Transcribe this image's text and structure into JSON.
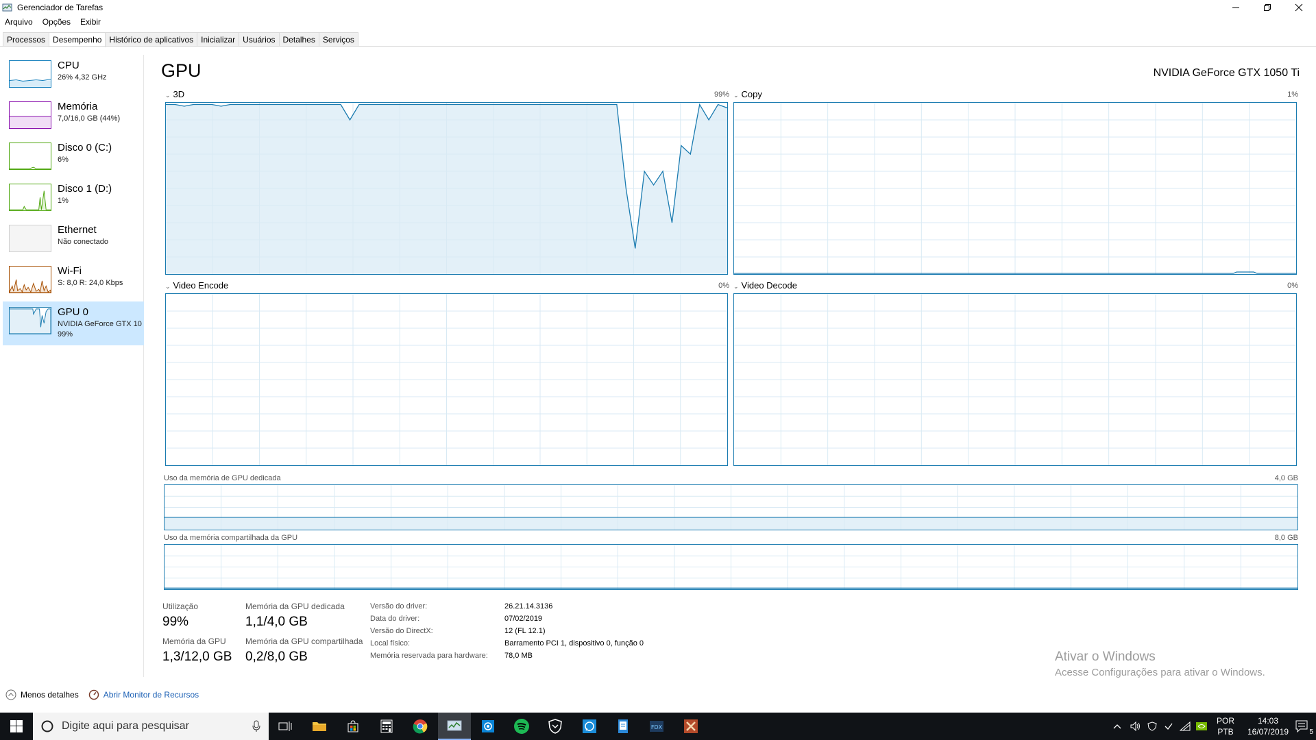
{
  "window": {
    "title": "Gerenciador de Tarefas",
    "menu": [
      "Arquivo",
      "Opções",
      "Exibir"
    ],
    "tabs": [
      "Processos",
      "Desempenho",
      "Histórico de aplicativos",
      "Inicializar",
      "Usuários",
      "Detalhes",
      "Serviços"
    ],
    "active_tab": "Desempenho"
  },
  "sidebar": {
    "items": [
      {
        "label": "CPU",
        "sub": "26% 4,32 GHz",
        "sub2": "",
        "color": "#117dbb"
      },
      {
        "label": "Memória",
        "sub": "7,0/16,0 GB (44%)",
        "sub2": "",
        "color": "#8b12ae"
      },
      {
        "label": "Disco 0 (C:)",
        "sub": "6%",
        "sub2": "",
        "color": "#4da60c"
      },
      {
        "label": "Disco 1 (D:)",
        "sub": "1%",
        "sub2": "",
        "color": "#4da60c"
      },
      {
        "label": "Ethernet",
        "sub": "Não conectado",
        "sub2": "",
        "color": "#a74f01"
      },
      {
        "label": "Wi-Fi",
        "sub": "S: 8,0  R: 24,0 Kbps",
        "sub2": "",
        "color": "#a74f01"
      },
      {
        "label": "GPU 0",
        "sub": "NVIDIA GeForce GTX 10",
        "sub2": "99%",
        "color": "#1a7bb0"
      }
    ],
    "selected_index": 6
  },
  "main": {
    "title": "GPU",
    "gpu_name": "NVIDIA GeForce GTX 1050 Ti",
    "graphs": [
      {
        "label": "3D",
        "percent": "99%"
      },
      {
        "label": "Copy",
        "percent": "1%"
      },
      {
        "label": "Video Encode",
        "percent": "0%"
      },
      {
        "label": "Video Decode",
        "percent": "0%"
      }
    ],
    "dedicated_memory": {
      "label": "Uso da memória de GPU dedicada",
      "max": "4,0 GB"
    },
    "shared_memory": {
      "label": "Uso da memória compartilhada da GPU",
      "max": "8,0 GB"
    },
    "stats": {
      "utilization_label": "Utilização",
      "utilization_value": "99%",
      "dedicated_label": "Memória da GPU dedicada",
      "dedicated_value": "1,1/4,0 GB",
      "gpu_memory_label": "Memória da GPU",
      "gpu_memory_value": "1,3/12,0 GB",
      "shared_label": "Memória da GPU compartilhada",
      "shared_value": "0,2/8,0 GB"
    },
    "info": [
      {
        "label": "Versão do driver:",
        "value": "26.21.14.3136"
      },
      {
        "label": "Data do driver:",
        "value": "07/02/2019"
      },
      {
        "label": "Versão do DirectX:",
        "value": "12 (FL 12.1)"
      },
      {
        "label": "Local físico:",
        "value": "Barramento PCI 1, dispositivo 0, função 0"
      },
      {
        "label": "Memória reservada para hardware:",
        "value": "78,0 MB"
      }
    ]
  },
  "chart_data": {
    "type": "line",
    "series": [
      {
        "name": "3D",
        "values": [
          99,
          99,
          98,
          99,
          99,
          99,
          98,
          99,
          99,
          99,
          99,
          99,
          99,
          99,
          99,
          99,
          99,
          99,
          99,
          99,
          90,
          99,
          99,
          99,
          99,
          99,
          99,
          99,
          99,
          99,
          99,
          99,
          99,
          99,
          99,
          99,
          99,
          99,
          99,
          99,
          99,
          99,
          99,
          99,
          99,
          99,
          99,
          99,
          99,
          99,
          50,
          15,
          60,
          52,
          60,
          30,
          75,
          70,
          99,
          90,
          99,
          97
        ]
      }
    ],
    "ylim": [
      0,
      100
    ]
  },
  "watermark": {
    "title": "Ativar o Windows",
    "subtitle": "Acesse Configurações para ativar o Windows."
  },
  "footer": {
    "less_details": "Menos detalhes",
    "resource_monitor": "Abrir Monitor de Recursos"
  },
  "taskbar": {
    "search_placeholder": "Digite aqui para pesquisar",
    "lang1": "POR",
    "lang2": "PTB",
    "time": "14:03",
    "date": "16/07/2019",
    "notifications": "5"
  }
}
